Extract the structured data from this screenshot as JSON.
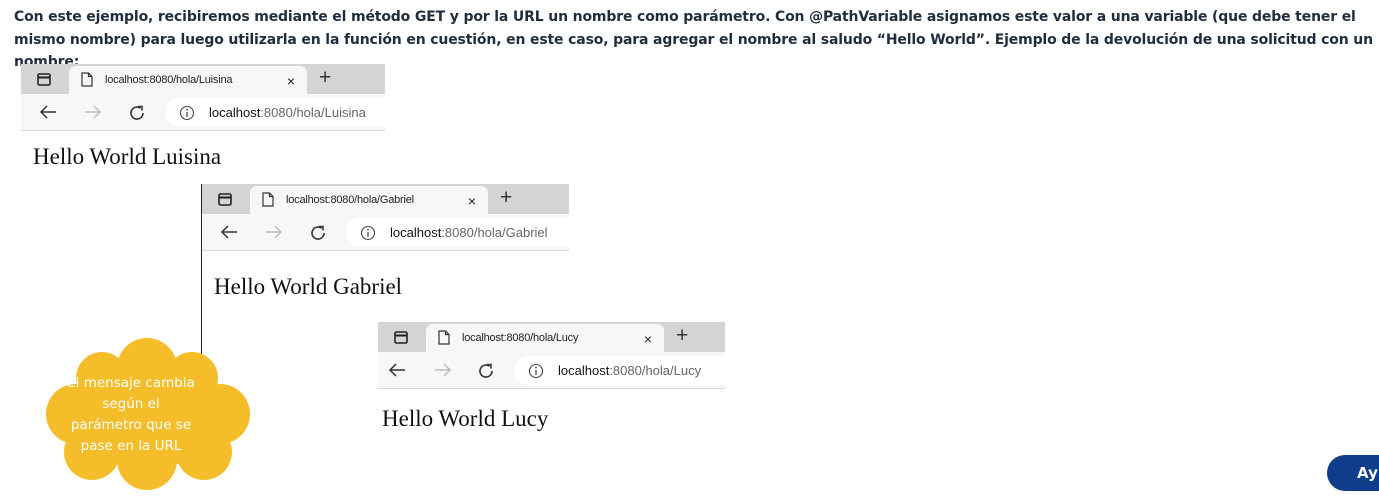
{
  "intro": {
    "paragraph": "Con este ejemplo, recibiremos mediante el método GET y por la URL un nombre como parámetro. Con @PathVariable asignamos este valor a una variable (que debe tener el mismo nombre) para luego utilizarla en la función en cuestión, en este caso, para agregar el nombre al saludo “Hello World”.  Ejemplo de la devolución de una solicitud con un nombre:"
  },
  "screenshots": [
    {
      "tab_title": "localhost:8080/hola/Luisina",
      "url_host": "localhost",
      "url_rest": ":8080/hola/Luisina",
      "body_text": "Hello World Luisina"
    },
    {
      "tab_title": "localhost:8080/hola/Gabriel",
      "url_host": "localhost",
      "url_rest": ":8080/hola/Gabriel",
      "body_text": "Hello World Gabriel"
    },
    {
      "tab_title": "localhost:8080/hola/Lucy",
      "url_host": "localhost",
      "url_rest": ":8080/hola/Lucy",
      "body_text": "Hello World Lucy"
    }
  ],
  "browser_icons": {
    "window": "tab-actions-icon",
    "doc": "page-icon",
    "close": "×",
    "new_tab": "+",
    "back": "back-arrow-icon",
    "forward": "forward-arrow-icon",
    "refresh": "refresh-icon",
    "info": "info-icon"
  },
  "callout": {
    "text": "El mensaje cambia según el parámetro que se pase en la URL",
    "color": "#f5bd2a"
  },
  "help_button": {
    "label": "Ay",
    "color": "#0f3d8c"
  }
}
